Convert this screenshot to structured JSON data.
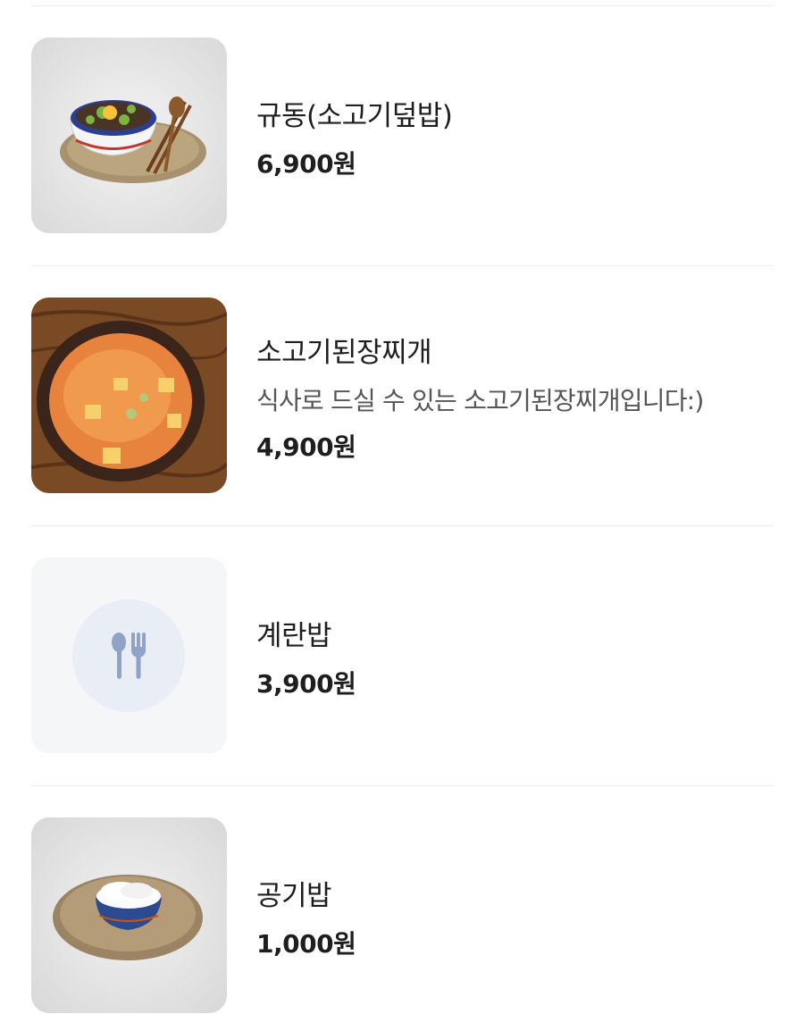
{
  "menu_items": [
    {
      "name": "규동(소고기덮밥)",
      "description": "",
      "price": "6,900원",
      "image": "beef-bowl-photo"
    },
    {
      "name": "소고기된장찌개",
      "description": "식사로 드실 수 있는 소고기된장찌개입니다:)",
      "price": "4,900원",
      "image": "soybean-stew-photo"
    },
    {
      "name": "계란밥",
      "description": "",
      "price": "3,900원",
      "image": "utensils-icon"
    },
    {
      "name": "공기밥",
      "description": "",
      "price": "1,000원",
      "image": "rice-bowl-photo"
    }
  ]
}
